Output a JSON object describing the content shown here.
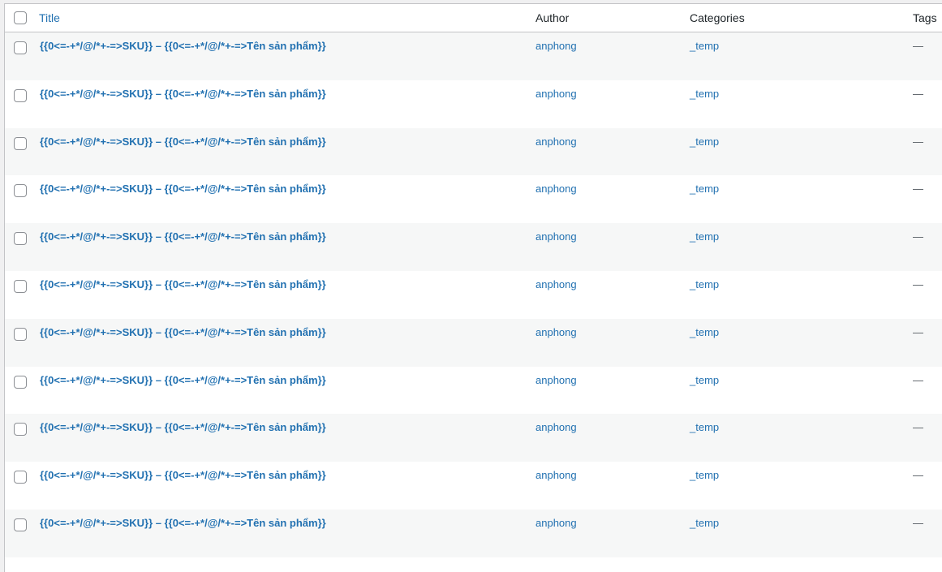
{
  "columns": {
    "title": "Title",
    "author": "Author",
    "categories": "Categories",
    "tags": "Tags"
  },
  "rows": [
    {
      "title": "{{0<=-+*/@/*+-=>SKU}} – {{0<=-+*/@/*+-=>Tên sản phẩm}}",
      "author": "anphong",
      "category": "_temp",
      "tags": "—"
    },
    {
      "title": "{{0<=-+*/@/*+-=>SKU}} – {{0<=-+*/@/*+-=>Tên sản phẩm}}",
      "author": "anphong",
      "category": "_temp",
      "tags": "—"
    },
    {
      "title": "{{0<=-+*/@/*+-=>SKU}} – {{0<=-+*/@/*+-=>Tên sản phẩm}}",
      "author": "anphong",
      "category": "_temp",
      "tags": "—"
    },
    {
      "title": "{{0<=-+*/@/*+-=>SKU}} – {{0<=-+*/@/*+-=>Tên sản phẩm}}",
      "author": "anphong",
      "category": "_temp",
      "tags": "—"
    },
    {
      "title": "{{0<=-+*/@/*+-=>SKU}} – {{0<=-+*/@/*+-=>Tên sản phẩm}}",
      "author": "anphong",
      "category": "_temp",
      "tags": "—"
    },
    {
      "title": "{{0<=-+*/@/*+-=>SKU}} – {{0<=-+*/@/*+-=>Tên sản phẩm}}",
      "author": "anphong",
      "category": "_temp",
      "tags": "—"
    },
    {
      "title": "{{0<=-+*/@/*+-=>SKU}} – {{0<=-+*/@/*+-=>Tên sản phẩm}}",
      "author": "anphong",
      "category": "_temp",
      "tags": "—"
    },
    {
      "title": "{{0<=-+*/@/*+-=>SKU}} – {{0<=-+*/@/*+-=>Tên sản phẩm}}",
      "author": "anphong",
      "category": "_temp",
      "tags": "—"
    },
    {
      "title": "{{0<=-+*/@/*+-=>SKU}} – {{0<=-+*/@/*+-=>Tên sản phẩm}}",
      "author": "anphong",
      "category": "_temp",
      "tags": "—"
    },
    {
      "title": "{{0<=-+*/@/*+-=>SKU}} – {{0<=-+*/@/*+-=>Tên sản phẩm}}",
      "author": "anphong",
      "category": "_temp",
      "tags": "—"
    },
    {
      "title": "{{0<=-+*/@/*+-=>SKU}} – {{0<=-+*/@/*+-=>Tên sản phẩm}}",
      "author": "anphong",
      "category": "_temp",
      "tags": "—"
    }
  ],
  "colors": {
    "link": "#2271b1",
    "row_alt": "#f6f7f7",
    "border": "#c3c4c7"
  }
}
